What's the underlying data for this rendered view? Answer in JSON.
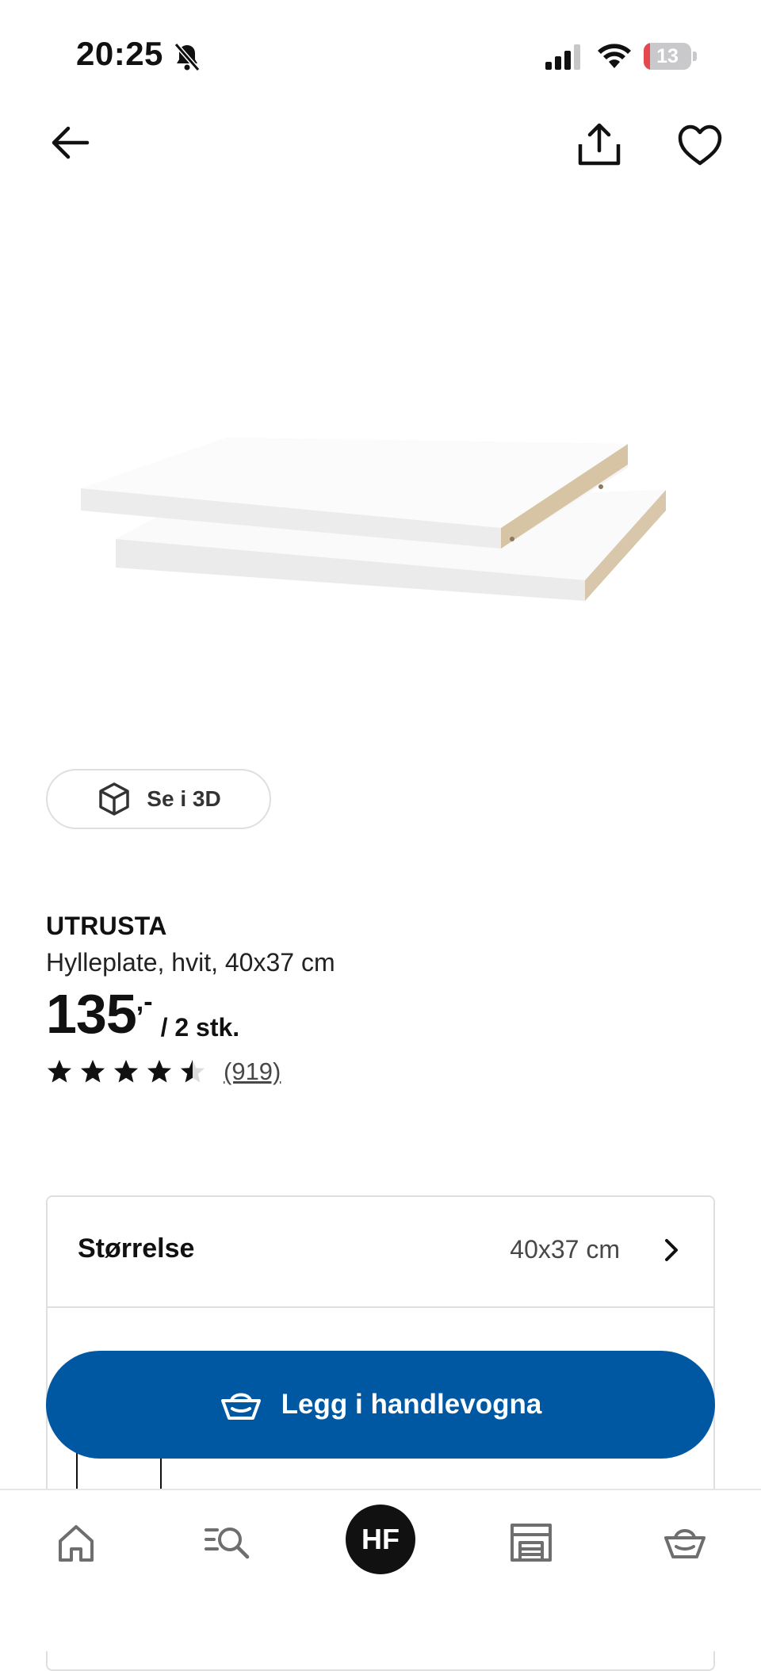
{
  "status_bar": {
    "time": "20:25",
    "battery_level": "13",
    "battery_fraction": 0.13,
    "battery_color": "#e5484d"
  },
  "nav": {
    "back_icon": "arrow-left-icon",
    "share_icon": "share-icon",
    "favorite_icon": "heart-icon"
  },
  "product": {
    "view_3d_label": "Se i 3D",
    "brand": "UTRUSTA",
    "description": "Hylleplate, hvit, 40x37 cm",
    "price_integer": "135",
    "price_decimal": ",-",
    "price_unit": "/ 2 stk.",
    "rating": 4.5,
    "rating_max": 5,
    "review_count": "(919)"
  },
  "options": {
    "size_label": "Størrelse",
    "size_value": "40x37 cm"
  },
  "cart_button": {
    "label": "Legg i handlevogna",
    "color": "#0058a3"
  },
  "tabbar": {
    "avatar_initials": "HF",
    "items": [
      "home-icon",
      "search-icon",
      "avatar",
      "store-icon",
      "basket-icon"
    ]
  }
}
